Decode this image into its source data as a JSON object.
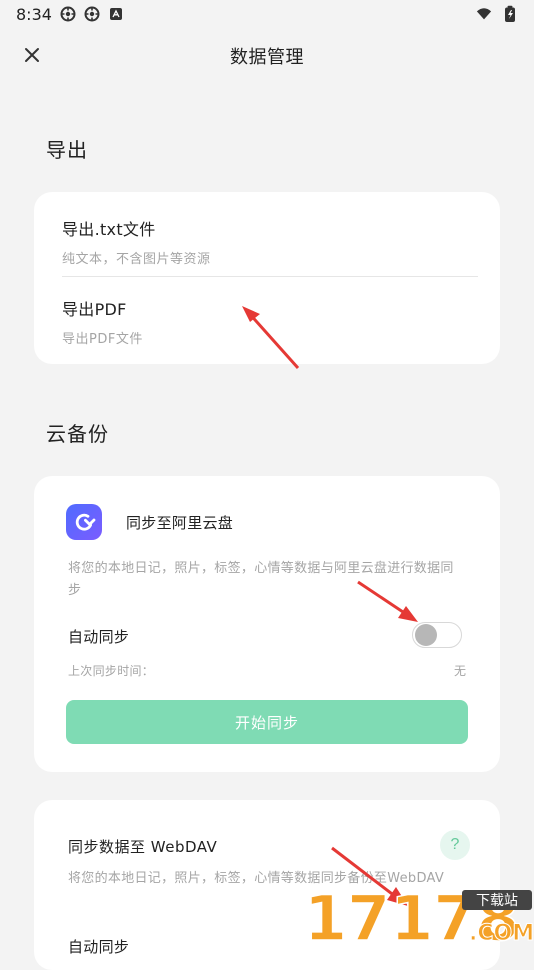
{
  "status_bar": {
    "time": "8:34",
    "icons": [
      "sync-icon",
      "sync-icon",
      "text-icon"
    ],
    "right_icons": [
      "wifi-icon",
      "battery-icon"
    ]
  },
  "header": {
    "title": "数据管理",
    "close_icon": "close-icon"
  },
  "sections": {
    "export": {
      "title": "导出",
      "items": [
        {
          "title": "导出.txt文件",
          "subtitle": "纯文本，不含图片等资源"
        },
        {
          "title": "导出PDF",
          "subtitle": "导出PDF文件"
        }
      ]
    },
    "cloud_backup": {
      "title": "云备份",
      "aliyun": {
        "title": "同步至阿里云盘",
        "description": "将您的本地日记，照片，标签，心情等数据与阿里云盘进行数据同步",
        "auto_sync_label": "自动同步",
        "last_sync_label": "上次同步时间：",
        "last_sync_value": "无",
        "button_label": "开始同步"
      },
      "webdav": {
        "title": "同步数据至 WebDAV",
        "help_label": "?",
        "description": "将您的本地日记，照片，标签，心情等数据同步备份至WebDAV",
        "auto_sync_label": "自动同步"
      }
    }
  },
  "watermark": {
    "brand": "17178",
    "top_label": "下载站",
    "bottom_label": ".COM"
  },
  "colors": {
    "background": "#f3f3f3",
    "card": "#ffffff",
    "primary_button": "#7fdbb4",
    "help_bg": "#e6f6ef",
    "help_text": "#63c99a",
    "logo_blue": "#4f6cff",
    "logo_purple": "#7b5cff",
    "arrow_red": "#e53935",
    "watermark_orange": "#f4a127",
    "watermark_dark": "#444444"
  }
}
